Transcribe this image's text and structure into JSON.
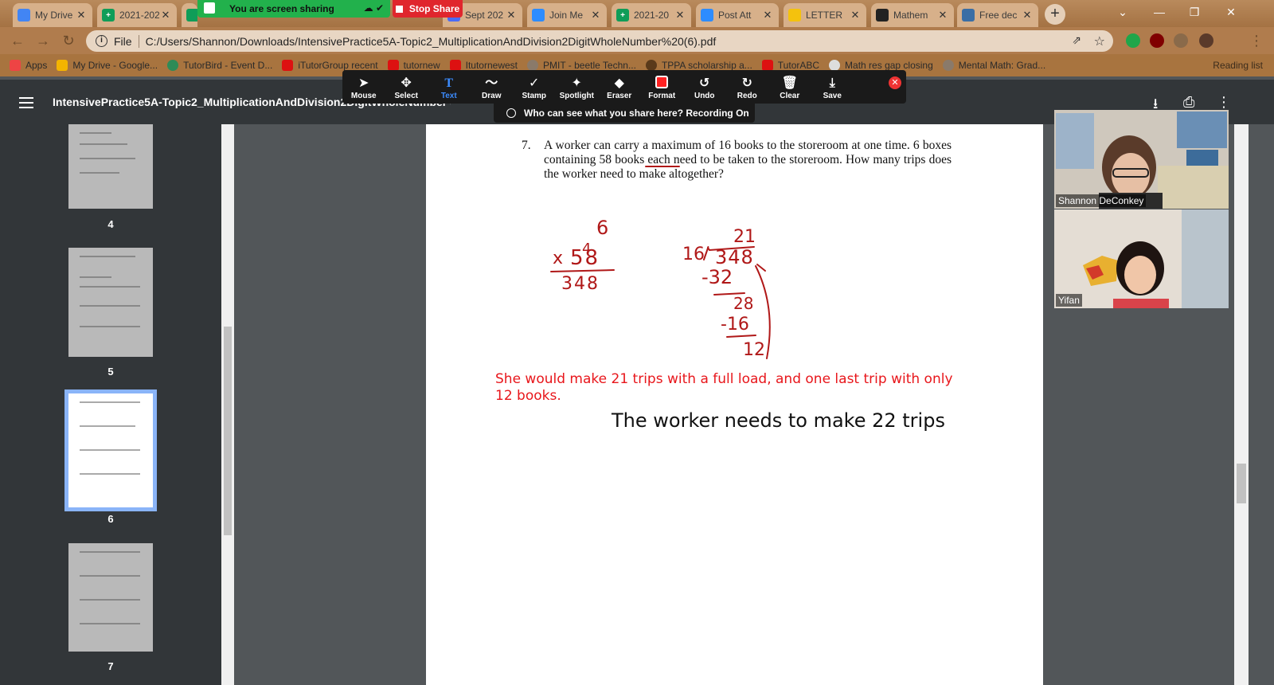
{
  "tabs": [
    {
      "title": "My Drive",
      "fav": "#4285f4"
    },
    {
      "title": "2021-202",
      "fav": "#0f9d58"
    },
    {
      "title": "",
      "fav": "#0f9d58"
    },
    {
      "title": "Sept 202",
      "fav": "#4a6cf7"
    },
    {
      "title": "Join Me",
      "fav": "#2d8cff"
    },
    {
      "title": "2021-20",
      "fav": "#0f9d58"
    },
    {
      "title": "Post Att",
      "fav": "#2d8cff"
    },
    {
      "title": "LETTER",
      "fav": "#f4c20d"
    },
    {
      "title": "Mathem",
      "fav": "#222222"
    },
    {
      "title": "Free dec",
      "fav": "#3a6ea5"
    }
  ],
  "share": {
    "banner": "You are screen sharing",
    "stop": "Stop Share"
  },
  "address": {
    "scheme": "File",
    "url": "C:/Users/Shannon/Downloads/IntensivePractice5A-Topic2_MultiplicationAndDivision2DigitWholeNumber%20(6).pdf"
  },
  "bookmarks": [
    "Apps",
    "My Drive - Google...",
    "TutorBird - Event D...",
    "iTutorGroup recent",
    "tutornew",
    "Itutornewest",
    "PMIT - beetle Techn...",
    "TPPA scholarship a...",
    "TutorABC",
    "Math res gap closing",
    "Mental Math: Grad..."
  ],
  "reading_list": "Reading list",
  "annot_tools": [
    "Mouse",
    "Select",
    "Text",
    "Draw",
    "Stamp",
    "Spotlight",
    "Eraser",
    "Format",
    "Undo",
    "Redo",
    "Clear",
    "Save"
  ],
  "annot_icons": [
    "arrow-cursor-icon",
    "move-icon",
    "text-icon",
    "squiggle-icon",
    "check-icon",
    "spotlight-icon",
    "eraser-icon",
    "format-icon",
    "undo-icon",
    "redo-icon",
    "trash-icon",
    "save-icon"
  ],
  "recording_notice": "Who can see what you share here? Recording On",
  "pdf": {
    "title": "IntensivePractice5A-Topic2_MultiplicationAndDivision2DigitWholeNumber (6).pdf"
  },
  "thumbs": [
    "4",
    "5",
    "6",
    "7"
  ],
  "question": {
    "number": "7.",
    "text": "A worker can carry a maximum of 16 books to the storeroom at one time. 6 boxes containing 58 books each need to be taken to the storeroom. How many trips does the worker need to make altogether?"
  },
  "work": {
    "carry_top": "6",
    "carry_small": "4",
    "mult_x": "x",
    "mult_num": "58",
    "product": "348",
    "divisor": "16",
    "dividend": "348",
    "quotient": "21",
    "step1": "-32",
    "rem1": "28",
    "step2": "-16",
    "rem2": "12"
  },
  "answer_note": "She would make 21 trips with a full load, and one last trip with only 12 books.",
  "answer_final": "The worker needs to make 22 trips",
  "participants": [
    {
      "name": "Shannon DeConkey"
    },
    {
      "name": "Yifan"
    }
  ],
  "colors": {
    "ink": "#b01818",
    "answer": "#e8161b",
    "zoom_green": "#22b14c",
    "zoom_red": "#e0262d"
  }
}
